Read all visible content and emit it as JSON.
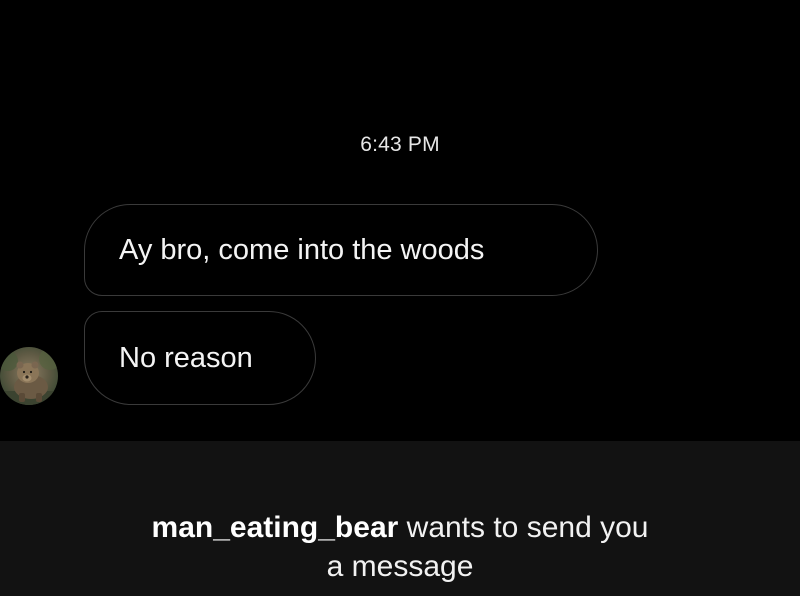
{
  "thread": {
    "timestamp": "6:43 PM",
    "messages": [
      {
        "text": "Ay bro, come into the woods"
      },
      {
        "text": "No reason"
      }
    ],
    "sender_avatar_icon": "bear-avatar-icon"
  },
  "message_request": {
    "username": "man_eating_bear",
    "text_line1": " wants to send you",
    "text_line2": "a message"
  },
  "colors": {
    "background": "#000000",
    "bubble_border": "#3a3a3a",
    "banner_background": "#121212",
    "text": "#f4f4f4"
  }
}
